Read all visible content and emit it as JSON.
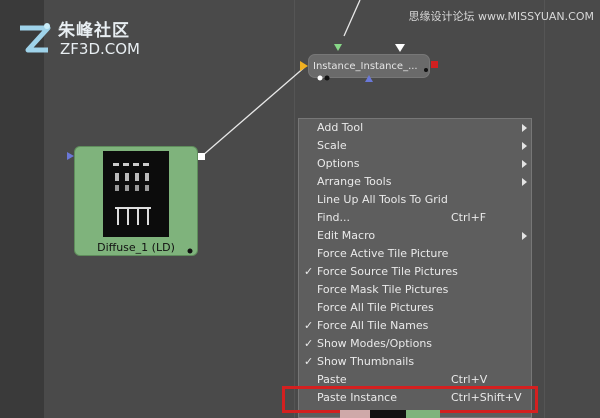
{
  "logo": {
    "cn_text": "朱峰社区",
    "en_text": "ZF3D.COM"
  },
  "watermark": "思缘设计论坛 www.MISSYUAN.COM",
  "nodes": {
    "instance": {
      "label": "Instance_Instance_..."
    },
    "diffuse": {
      "label": "Diffuse_1  (LD)"
    }
  },
  "context_menu": {
    "items": [
      {
        "label": "Add Tool",
        "submenu": true
      },
      {
        "label": "Scale",
        "submenu": true
      },
      {
        "label": "Options",
        "submenu": true
      },
      {
        "label": "Arrange Tools",
        "submenu": true
      },
      {
        "label": "Line Up All Tools To Grid"
      },
      {
        "label": "Find...",
        "shortcut": "Ctrl+F"
      },
      {
        "label": "Edit Macro",
        "submenu": true
      },
      {
        "label": "Force Active Tile Picture"
      },
      {
        "label": "Force Source Tile Pictures",
        "checked": true
      },
      {
        "label": "Force Mask Tile Pictures"
      },
      {
        "label": "Force All Tile Pictures"
      },
      {
        "label": "Force All Tile Names",
        "checked": true
      },
      {
        "label": "Show Modes/Options",
        "checked": true
      },
      {
        "label": "Show Thumbnails",
        "checked": true
      },
      {
        "label": "Paste",
        "shortcut": "Ctrl+V"
      },
      {
        "label": "Paste Instance",
        "shortcut": "Ctrl+Shift+V",
        "highlighted": true
      }
    ]
  },
  "colors": {
    "canvas": "#4a4a4a",
    "menu_bg": "#5e5e5e",
    "highlight": "#d42020",
    "diffuse_node": "#7fb37c"
  }
}
